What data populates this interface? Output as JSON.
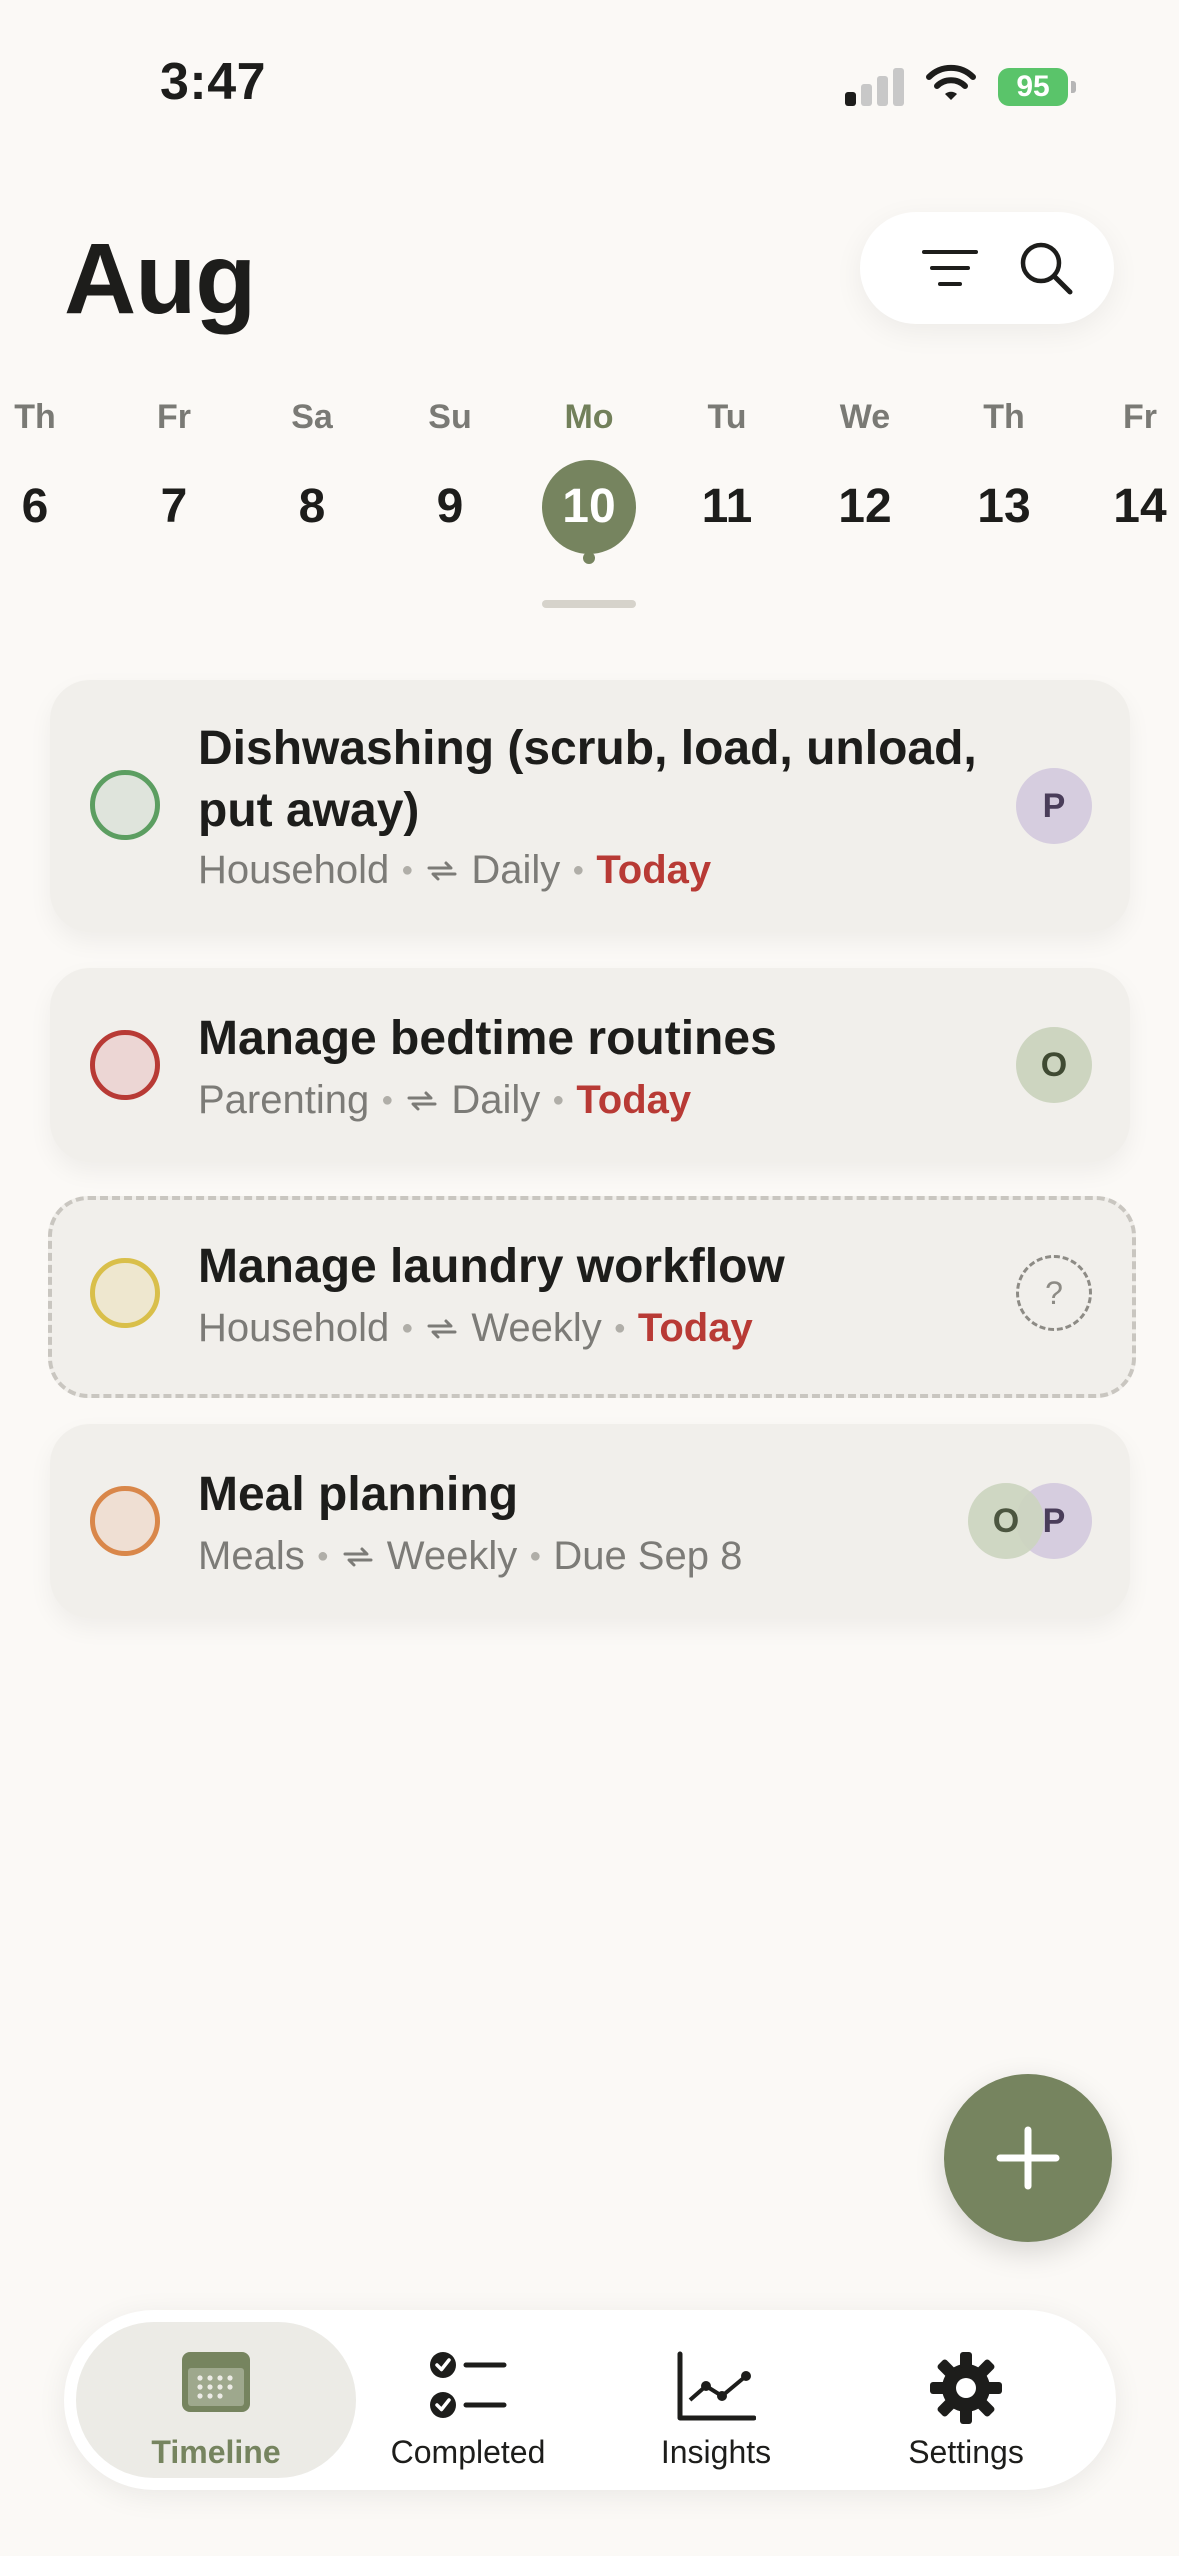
{
  "status_bar": {
    "time": "3:47",
    "battery": "95"
  },
  "header": {
    "month": "Aug"
  },
  "calendar": {
    "days": [
      {
        "abbr": "Th",
        "num": "6"
      },
      {
        "abbr": "Fr",
        "num": "7"
      },
      {
        "abbr": "Sa",
        "num": "8"
      },
      {
        "abbr": "Su",
        "num": "9"
      },
      {
        "abbr": "Mo",
        "num": "10"
      },
      {
        "abbr": "Tu",
        "num": "11"
      },
      {
        "abbr": "We",
        "num": "12"
      },
      {
        "abbr": "Th",
        "num": "13"
      },
      {
        "abbr": "Fr",
        "num": "14"
      }
    ],
    "selected_index": 4
  },
  "tasks": [
    {
      "title": "Dishwashing (scrub, load, unload, put away)",
      "category": "Household",
      "repeat": "Daily",
      "due": "Today",
      "check_color": "#5c9e61",
      "check_fill": "#dfe4dc",
      "avatar": "P"
    },
    {
      "title": "Manage bedtime routines",
      "category": "Parenting",
      "repeat": "Daily",
      "due": "Today",
      "check_color": "#b83a35",
      "check_fill": "#ecd6d4",
      "avatar": "O"
    },
    {
      "title": "Manage laundry workflow",
      "category": "Household",
      "repeat": "Weekly",
      "due": "Today",
      "check_color": "#d9bf4a",
      "check_fill": "#eee7cf",
      "avatar": "?"
    },
    {
      "title": "Meal planning",
      "category": "Meals",
      "repeat": "Weekly",
      "due": "Due Sep 8",
      "check_color": "#d9874a",
      "check_fill": "#efdfd3",
      "avatars": [
        "O",
        "P"
      ]
    }
  ],
  "tabbar": {
    "tabs": [
      {
        "label": "Timeline",
        "icon": "calendar-icon",
        "active": true
      },
      {
        "label": "Completed",
        "icon": "checklist-icon",
        "active": false
      },
      {
        "label": "Insights",
        "icon": "chart-icon",
        "active": false
      },
      {
        "label": "Settings",
        "icon": "gear-icon",
        "active": false
      }
    ]
  },
  "colors": {
    "accent": "#76845f",
    "due_today": "#b83a35",
    "background": "#fbf9f6"
  }
}
